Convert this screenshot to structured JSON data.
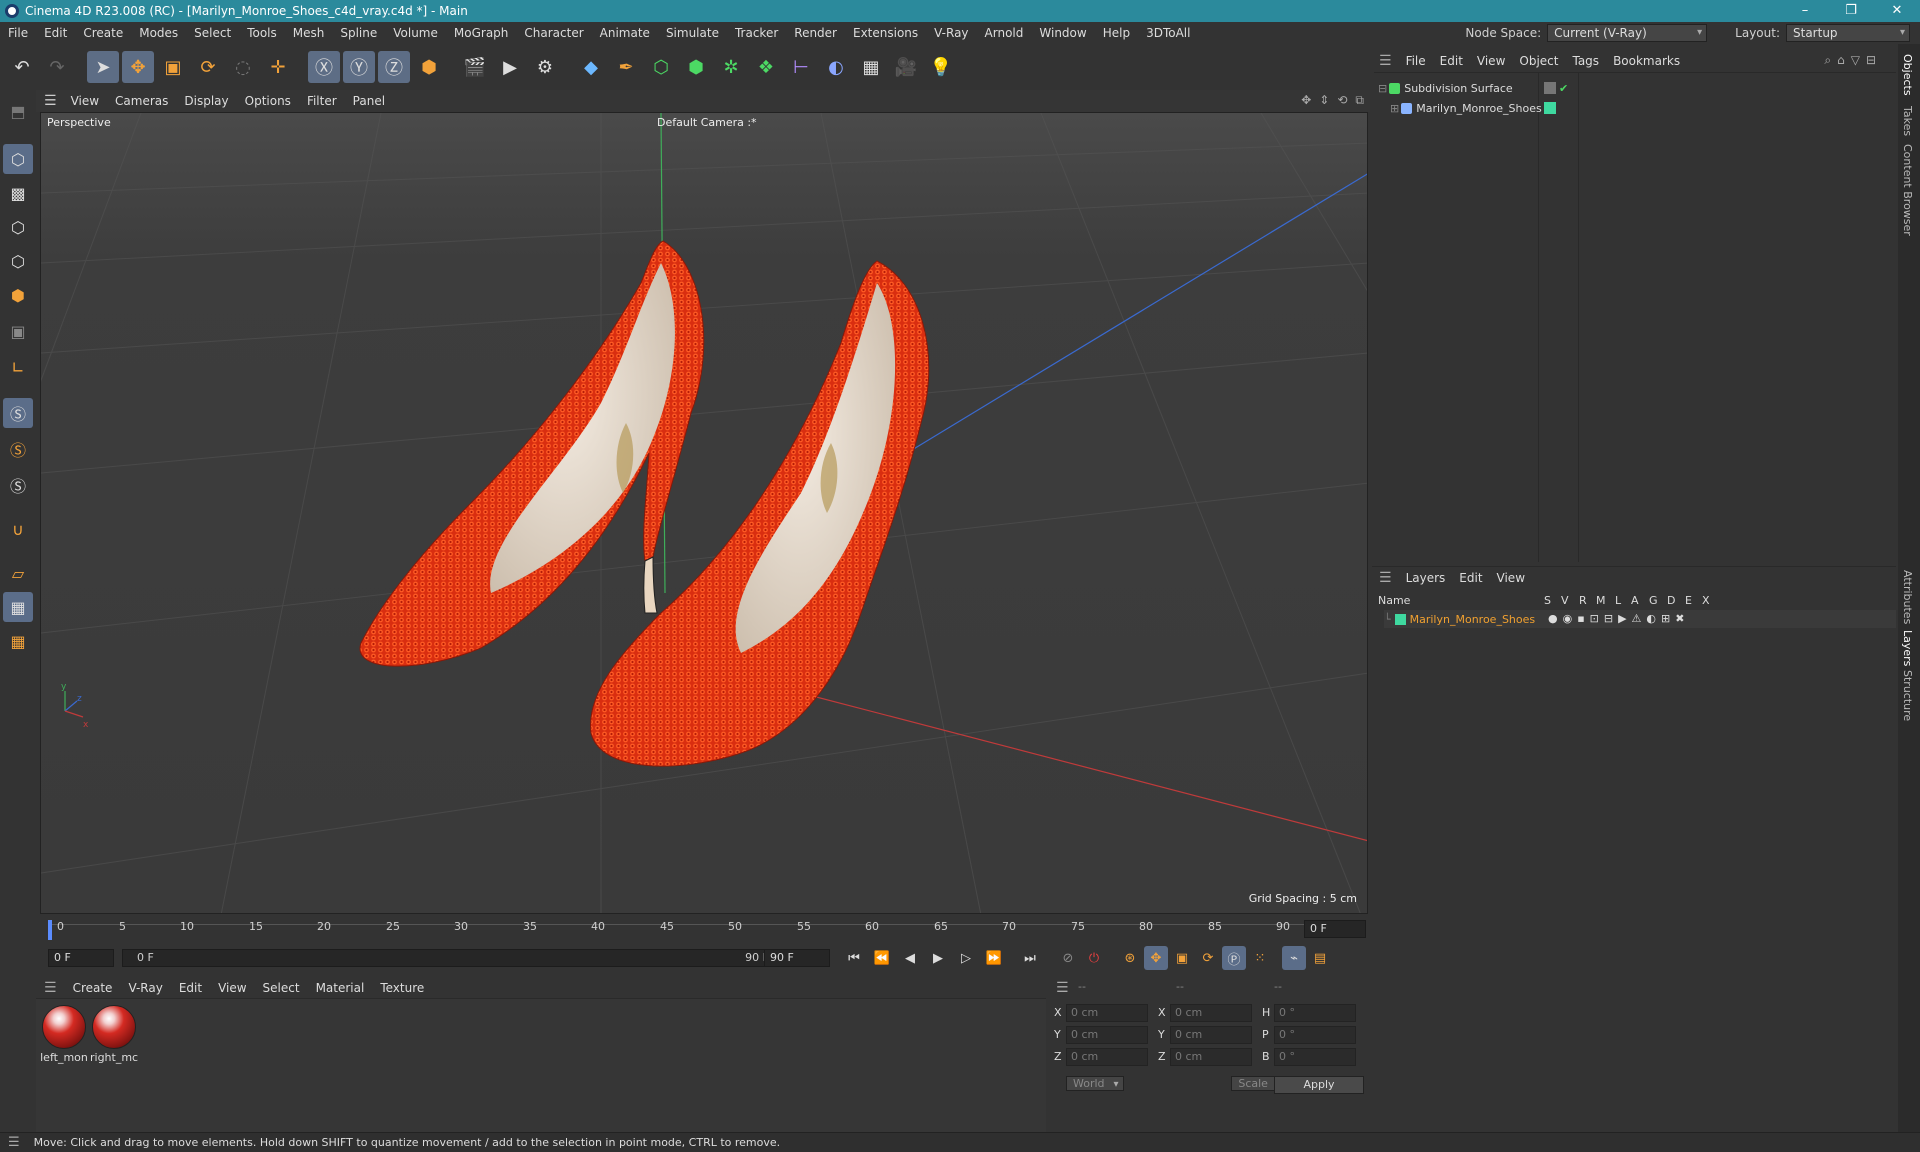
{
  "window": {
    "title": "Cinema 4D R23.008 (RC) - [Marilyn_Monroe_Shoes_c4d_vray.c4d *] - Main"
  },
  "menu": [
    "File",
    "Edit",
    "Create",
    "Modes",
    "Select",
    "Tools",
    "Mesh",
    "Spline",
    "Volume",
    "MoGraph",
    "Character",
    "Animate",
    "Simulate",
    "Tracker",
    "Render",
    "Extensions",
    "V-Ray",
    "Arnold",
    "Window",
    "Help",
    "3DToAll"
  ],
  "node_space": {
    "label": "Node Space:",
    "value": "Current (V-Ray)"
  },
  "layout": {
    "label": "Layout:",
    "value": "Startup"
  },
  "viewport": {
    "menu": [
      "View",
      "Cameras",
      "Display",
      "Options",
      "Filter",
      "Panel"
    ],
    "projection": "Perspective",
    "camera": "Default Camera :*",
    "grid_spacing": "Grid Spacing : 5 cm",
    "axis_x": "x",
    "axis_y": "y",
    "axis_z": "z"
  },
  "timeline": {
    "ticks": [
      "0",
      "5",
      "10",
      "15",
      "20",
      "25",
      "30",
      "35",
      "40",
      "45",
      "50",
      "55",
      "60",
      "65",
      "70",
      "75",
      "80",
      "85",
      "90"
    ],
    "current_frame": "0 F"
  },
  "transport": {
    "start": "0 F",
    "range_start": "0 F",
    "range_end": "90 F",
    "end": "90 F"
  },
  "materials": {
    "menu": [
      "Create",
      "V-Ray",
      "Edit",
      "View",
      "Select",
      "Material",
      "Texture"
    ],
    "items": [
      {
        "name": "left_mon"
      },
      {
        "name": "right_mc"
      }
    ]
  },
  "coords": {
    "head": [
      "--",
      "--",
      "--"
    ],
    "rows": [
      {
        "a": "X",
        "v1": "0 cm",
        "b": "X",
        "v2": "0 cm",
        "c": "H",
        "v3": "0 °"
      },
      {
        "a": "Y",
        "v1": "0 cm",
        "b": "Y",
        "v2": "0 cm",
        "c": "P",
        "v3": "0 °"
      },
      {
        "a": "Z",
        "v1": "0 cm",
        "b": "Z",
        "v2": "0 cm",
        "c": "B",
        "v3": "0 °"
      }
    ],
    "world": "World",
    "scale": "Scale",
    "apply": "Apply"
  },
  "status": "Move: Click and drag to move elements. Hold down SHIFT to quantize movement / add to the selection in point mode, CTRL to remove.",
  "objects_panel": {
    "menu": [
      "File",
      "Edit",
      "View",
      "Object",
      "Tags",
      "Bookmarks"
    ],
    "items": [
      {
        "name": "Subdivision Surface"
      },
      {
        "name": "Marilyn_Monroe_Shoes"
      }
    ]
  },
  "layers_panel": {
    "menu": [
      "Layers",
      "Edit",
      "View"
    ],
    "columns": [
      "Name",
      "S",
      "V",
      "R",
      "M",
      "L",
      "A",
      "G",
      "D",
      "E",
      "X"
    ],
    "items": [
      {
        "name": "Marilyn_Monroe_Shoes",
        "color": "#3fd9a0"
      }
    ]
  },
  "side_tabs": [
    "Objects",
    "Takes",
    "Content Browser",
    "Attributes",
    "Layers",
    "Structure"
  ],
  "colors": {
    "titlebar": "#2b8a9c",
    "selection": "#5b6d89",
    "shoe_red": "#e83a14",
    "layer_green": "#3fd9a0",
    "layer_name": "#f0a030"
  }
}
